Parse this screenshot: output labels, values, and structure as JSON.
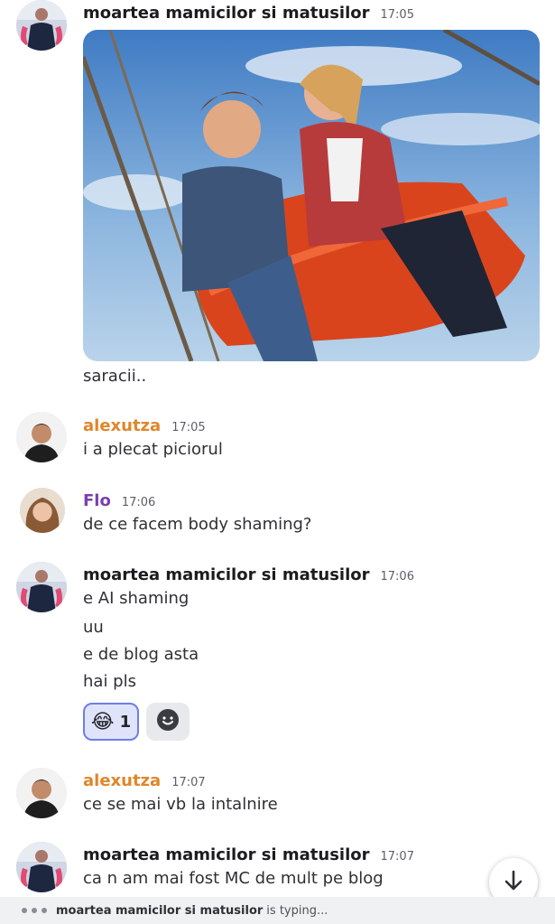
{
  "messages": [
    {
      "author": "moartea mamicilor si matusilor",
      "time": "17:05",
      "image": "roller-coaster-photo",
      "lines": [
        "saracii.."
      ]
    },
    {
      "author": "alexutza",
      "time": "17:05",
      "lines": [
        "i a plecat piciorul"
      ]
    },
    {
      "author": "Flo",
      "time": "17:06",
      "lines": [
        "de ce facem body shaming?"
      ]
    },
    {
      "author": "moartea mamicilor si matusilor",
      "time": "17:06",
      "lines": [
        "e AI shaming",
        "uu",
        "e de blog asta",
        "hai pls"
      ],
      "reactions": [
        {
          "emoji": "😂",
          "count": "1"
        }
      ]
    },
    {
      "author": "alexutza",
      "time": "17:07",
      "lines": [
        "ce se mai vb la intalnire"
      ]
    },
    {
      "author": "moartea mamicilor si matusilor",
      "time": "17:07",
      "lines": [
        "ca n am mai fost MC de mult pe blog"
      ]
    }
  ],
  "typing": {
    "user": "moartea mamicilor si matusilor",
    "suffix": "is typing..."
  },
  "icons": {
    "add_reaction": "smile-icon",
    "jump_to_present": "arrow-down-icon"
  },
  "colors": {
    "alexutza": "#e0862a",
    "flo": "#7a3fb0",
    "reaction_border": "#6f7de8"
  }
}
